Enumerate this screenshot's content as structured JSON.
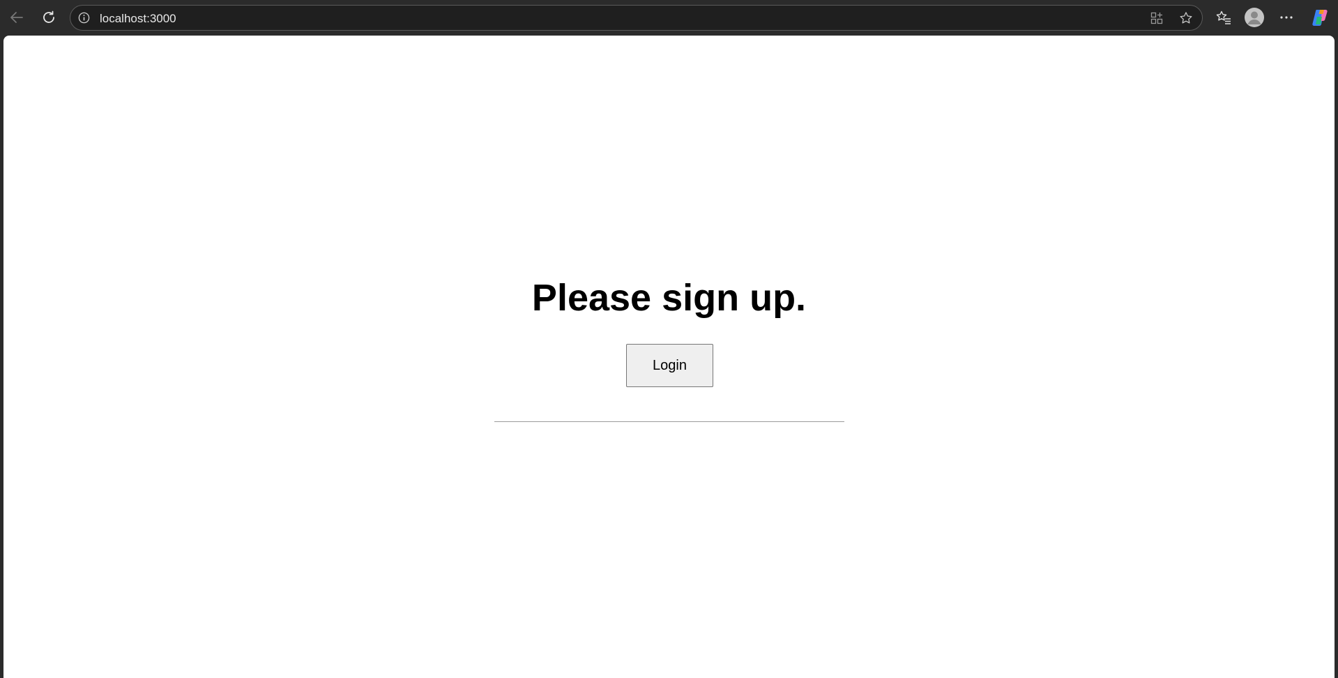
{
  "browser": {
    "url": "localhost:3000",
    "icons": {
      "back": "arrow-left-icon",
      "reload": "reload-icon",
      "site_info": "info-icon",
      "apps": "app-grid-icon",
      "favorite": "star-icon",
      "favorites_list": "favorites-icon",
      "profile": "avatar-icon",
      "more": "more-dots-icon",
      "copilot": "copilot-icon"
    }
  },
  "page": {
    "heading": "Please sign up.",
    "login_label": "Login"
  },
  "colors": {
    "chrome_bg": "#2b2b2b",
    "page_bg": "#ffffff",
    "button_bg": "#efefef"
  }
}
